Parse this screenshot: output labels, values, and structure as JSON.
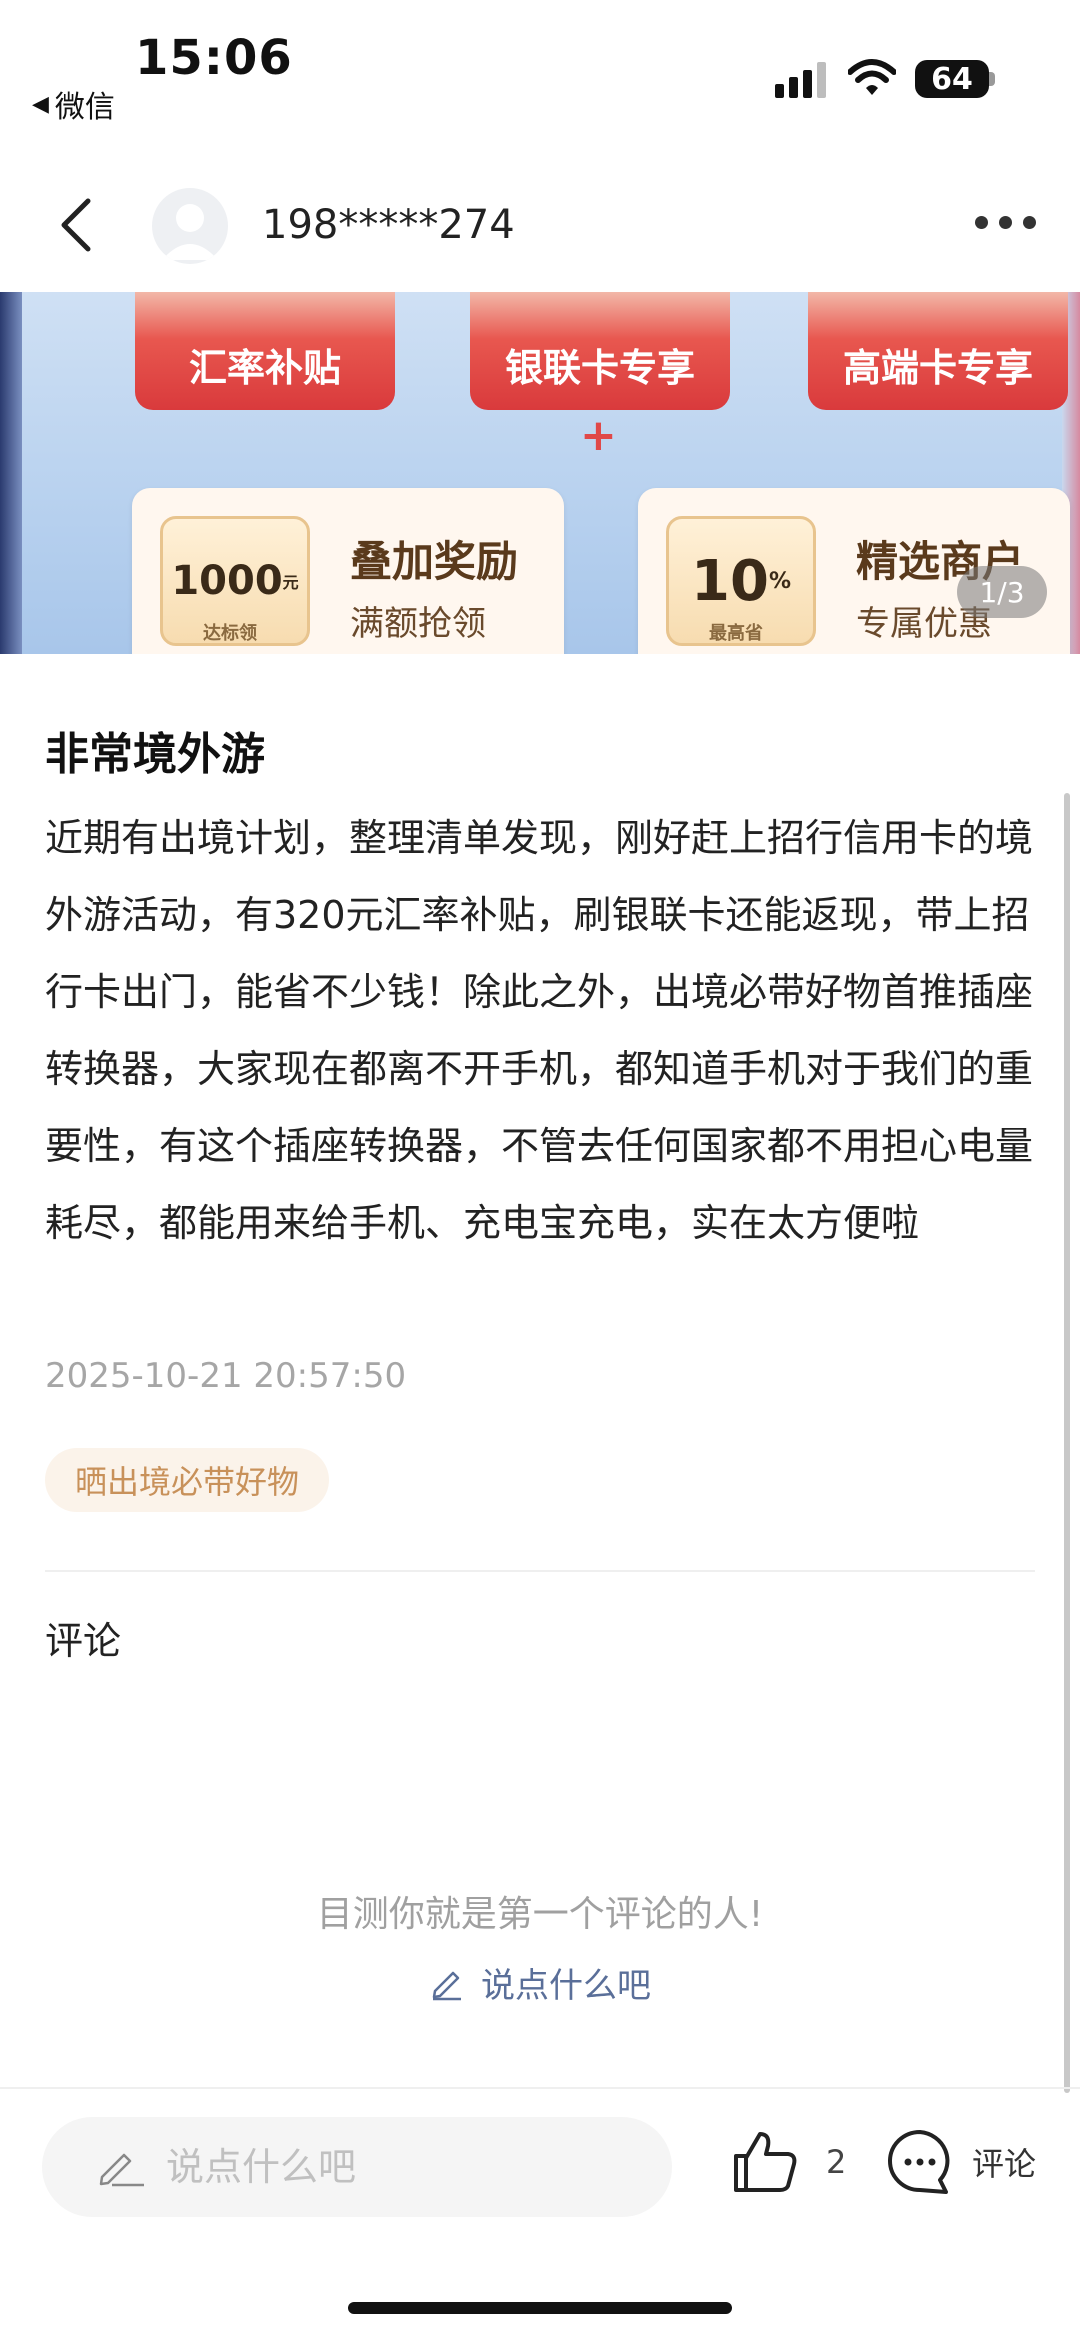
{
  "status_bar": {
    "time": "15:06",
    "back_app": "微信",
    "battery": "64"
  },
  "header": {
    "username": "198*****274",
    "icons": [
      "chevron-left-icon",
      "avatar",
      "more-dots-icon"
    ]
  },
  "banner": {
    "tags": [
      "汇率补贴",
      "银联卡专享",
      "高端卡专享"
    ],
    "plus": "+",
    "cards": [
      {
        "badge": "1000",
        "badge_unit": "元",
        "badge_sub": "达标领",
        "title": "叠加奖励",
        "subtitle": "满额抢领"
      },
      {
        "badge": "10",
        "badge_unit": "%",
        "badge_sub": "最高省",
        "title": "精选商户",
        "subtitle": "专属优惠"
      }
    ],
    "counter": "1/3"
  },
  "post": {
    "title": "非常境外游",
    "body": "近期有出境计划，整理清单发现，刚好赶上招行信用卡的境外游活动，有320元汇率补贴，刷银联卡还能返现，带上招行卡出门，能省不少钱！除此之外，出境必带好物首推插座转换器，大家现在都离不开手机，都知道手机对于我们的重要性，有这个插座转换器，不管去任何国家都不用担心电量耗尽，都能用来给手机、充电宝充电，实在太方便啦",
    "timestamp": "2025-10-21 20:57:50",
    "tag": "晒出境必带好物"
  },
  "comments": {
    "heading": "评论",
    "empty_text": "目测你就是第一个评论的人!",
    "say_link": "说点什么吧"
  },
  "bottom_bar": {
    "input_placeholder": "说点什么吧",
    "like_count": "2",
    "comment_label": "评论"
  },
  "colors": {
    "tag_bg": "#fbf3ea",
    "tag_text": "#c8915a",
    "link": "#5a6f99",
    "banner_red": "#d93a3c"
  }
}
